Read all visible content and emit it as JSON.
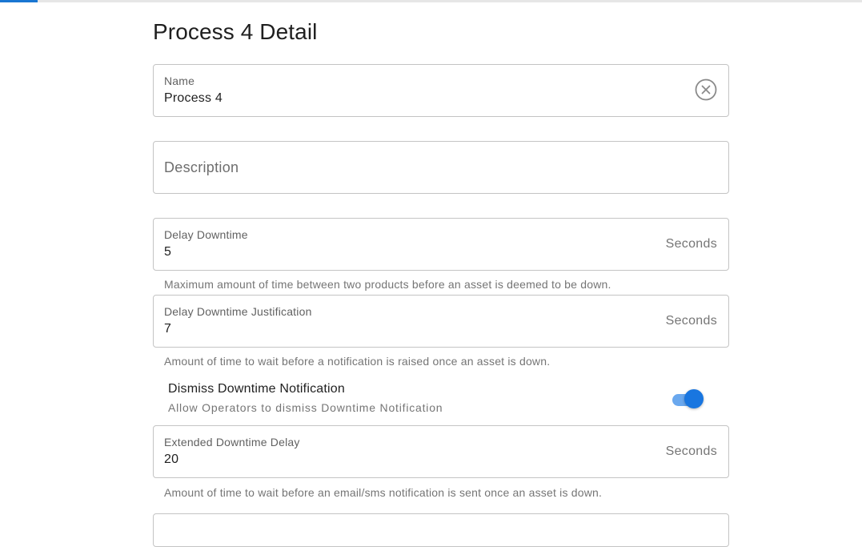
{
  "page": {
    "title": "Process 4 Detail"
  },
  "loading_bar": {
    "progress_fraction": 0.044,
    "color": "#1976d2"
  },
  "fields": {
    "name": {
      "label": "Name",
      "value": "Process 4",
      "clear_icon": "close-circle-icon"
    },
    "description": {
      "placeholder": "Description"
    },
    "delay_downtime": {
      "label": "Delay Downtime",
      "value": "5",
      "suffix": "Seconds",
      "helper": "Maximum amount of time between two products before an asset is deemed to be down."
    },
    "delay_downtime_justification": {
      "label": "Delay Downtime Justification",
      "value": "7",
      "suffix": "Seconds",
      "helper": "Amount of time to wait before a notification is raised once an asset is down."
    },
    "extended_downtime_delay": {
      "label": "Extended Downtime Delay",
      "value": "20",
      "suffix": "Seconds",
      "helper": "Amount of time to wait before an email/sms notification is sent once an asset is down."
    }
  },
  "dismiss_toggle": {
    "title": "Dismiss Downtime Notification",
    "subtitle": "Allow Operators to dismiss Downtime Notification",
    "checked": true,
    "accent_color": "#1976e0"
  }
}
